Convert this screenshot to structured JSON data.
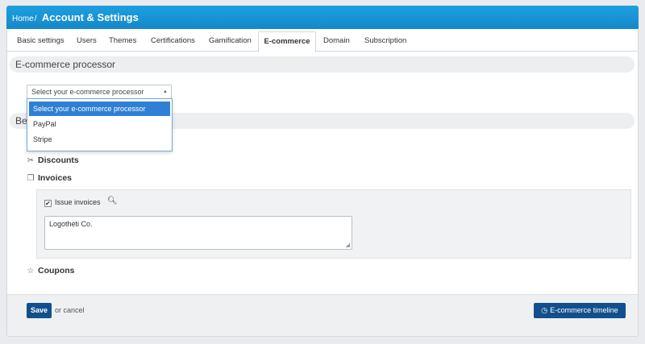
{
  "header": {
    "breadcrumb_home": "Home",
    "breadcrumb_sep": "/",
    "title": "Account & Settings"
  },
  "tabs": [
    {
      "label": "Basic settings"
    },
    {
      "label": "Users"
    },
    {
      "label": "Themes"
    },
    {
      "label": "Certifications"
    },
    {
      "label": "Gamification"
    },
    {
      "label": "E-commerce",
      "active": true
    },
    {
      "label": "Domain"
    },
    {
      "label": "Subscription"
    }
  ],
  "processor_section": {
    "title": "E-commerce processor",
    "select_value": "Select your e-commerce processor",
    "options": [
      "Select your e-commerce processor",
      "PayPal",
      "Stripe"
    ]
  },
  "benefits_section": {
    "title_partial": "Be"
  },
  "features": {
    "discounts": "Discounts",
    "invoices": "Invoices",
    "coupons": "Coupons"
  },
  "invoices_panel": {
    "issue_invoices_label": "Issue invoices",
    "issue_invoices_checked": true,
    "company_text": "Logotheti Co."
  },
  "footer": {
    "save_label": "Save",
    "or_text": "or",
    "cancel_label": "cancel",
    "timeline_label": "E-commerce timeline"
  },
  "colors": {
    "header_blue": "#1488c9",
    "button_blue": "#12508d",
    "selected_option": "#2f7fd6"
  }
}
